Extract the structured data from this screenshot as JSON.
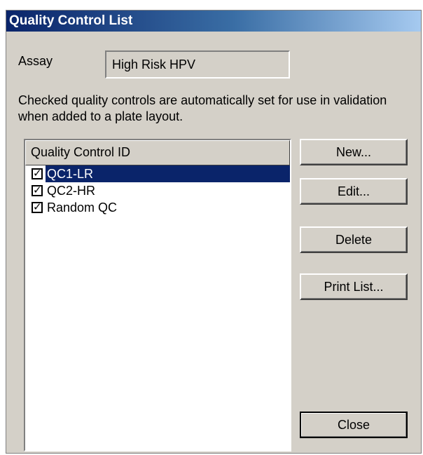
{
  "window": {
    "title": "Quality Control List"
  },
  "assay": {
    "label": "Assay",
    "value": "High Risk HPV"
  },
  "description": "Checked quality controls are automatically set for use in validation when added to a plate layout.",
  "list": {
    "header": "Quality Control ID",
    "items": [
      {
        "label": "QC1-LR",
        "checked": true,
        "selected": true
      },
      {
        "label": "QC2-HR",
        "checked": true,
        "selected": false
      },
      {
        "label": "Random QC",
        "checked": true,
        "selected": false
      }
    ]
  },
  "buttons": {
    "new": "New...",
    "edit": "Edit...",
    "delete": "Delete",
    "print": "Print List...",
    "close": "Close"
  },
  "colors": {
    "selection": "#0a246a",
    "dialog_bg": "#d4d0c8"
  }
}
